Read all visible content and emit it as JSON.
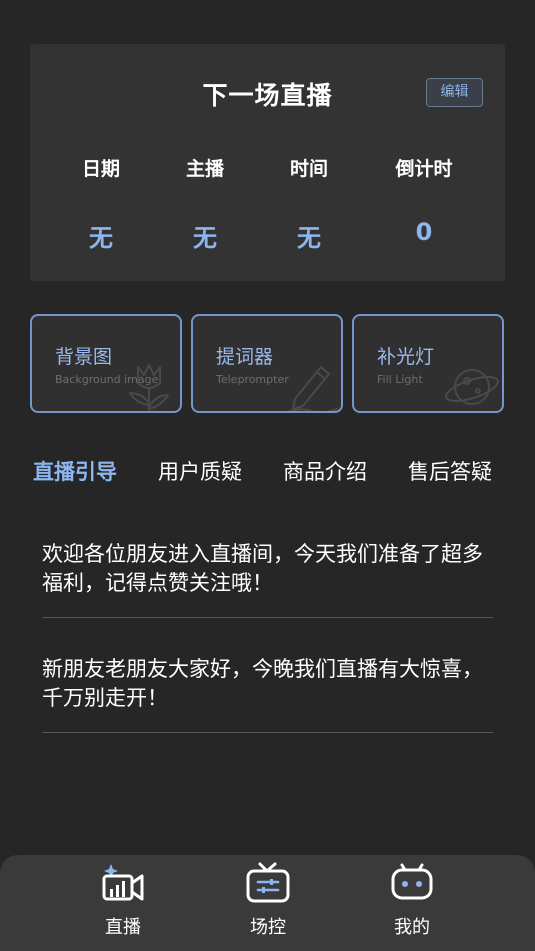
{
  "live_card": {
    "title": "下一场直播",
    "edit_label": "编辑",
    "stats": [
      {
        "label": "日期",
        "value": "无"
      },
      {
        "label": "主播",
        "value": "无"
      },
      {
        "label": "时间",
        "value": "无"
      },
      {
        "label": "倒计时",
        "value": "0"
      }
    ]
  },
  "tools": [
    {
      "title": "背景图",
      "subtitle": "Background image",
      "icon": "tulip-icon"
    },
    {
      "title": "提词器",
      "subtitle": "Teleprompter",
      "icon": "pen-icon"
    },
    {
      "title": "补光灯",
      "subtitle": "Fill Light",
      "icon": "planet-icon"
    }
  ],
  "tabs": [
    {
      "label": "直播引导",
      "active": true
    },
    {
      "label": "用户质疑",
      "active": false
    },
    {
      "label": "商品介绍",
      "active": false
    },
    {
      "label": "售后答疑",
      "active": false
    }
  ],
  "scripts": [
    {
      "text": "欢迎各位朋友进入直播间，今天我们准备了超多福利，记得点赞关注哦！"
    },
    {
      "text": "新朋友老朋友大家好，今晚我们直播有大惊喜，千万别走开！"
    }
  ],
  "bottom_nav": [
    {
      "label": "直播",
      "icon": "live-camera-icon"
    },
    {
      "label": "场控",
      "icon": "tv-control-icon"
    },
    {
      "label": "我的",
      "icon": "robot-face-icon"
    }
  ],
  "colors": {
    "background": "#262626",
    "card": "#333333",
    "accent": "#8db6f1",
    "tool_border": "#7596cc",
    "nav_bar": "#3a3a3a"
  }
}
